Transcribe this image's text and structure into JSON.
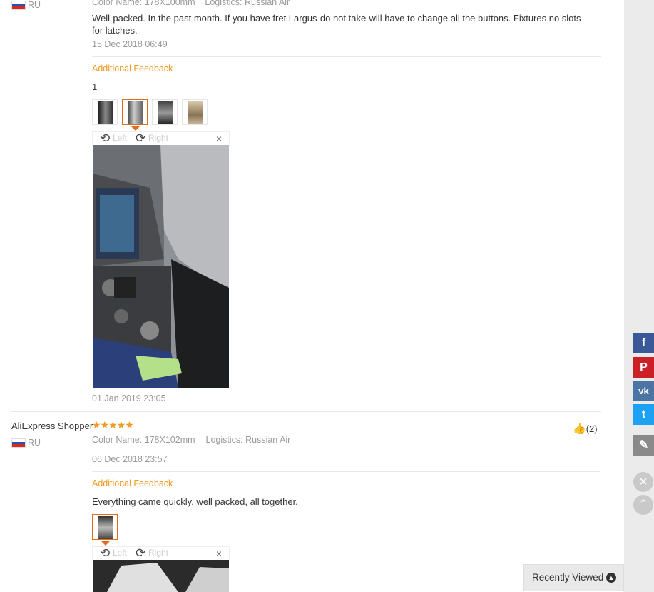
{
  "review1": {
    "country": "RU",
    "meta": "Color Name: 178X100mm    Logistics: Russian Air",
    "text": "Well-packed. In the past month. If you have fret Largus-do not take-will have to change all the buttons. Fixtures no slots for latches.",
    "date": "15 Dec 2018 06:49",
    "additional_label": "Additional Feedback",
    "additional_text": "1",
    "viewer": {
      "left": "Left",
      "right": "Right",
      "close": "×"
    },
    "additional_date": "01 Jan 2019 23:05"
  },
  "review2": {
    "author": "AliExpress Shopper",
    "stars": "★★★★★",
    "country": "RU",
    "color_label": "Color Name:",
    "color_value": "178X102mm",
    "logistics_label": "Logistics:",
    "logistics_value": "Russian Air",
    "likes": "(2)",
    "date": "06 Dec 2018 23:57",
    "additional_label": "Additional Feedback",
    "additional_text": "Everything came quickly, well packed, all together.",
    "viewer": {
      "left": "Left",
      "right": "Right",
      "close": "×"
    }
  },
  "share": {
    "facebook": "f",
    "pinterest": "P",
    "vk": "vk",
    "twitter": "t",
    "edit": "✎"
  },
  "controls": {
    "close": "×",
    "up": "⌃"
  },
  "recently_viewed": {
    "label": "Recently Viewed",
    "icon": "▲"
  },
  "colors": {
    "accent": "#f29a23",
    "facebook": "#3b5998",
    "pinterest": "#cb2027",
    "vk": "#4c75a3",
    "twitter": "#1da1f2"
  }
}
